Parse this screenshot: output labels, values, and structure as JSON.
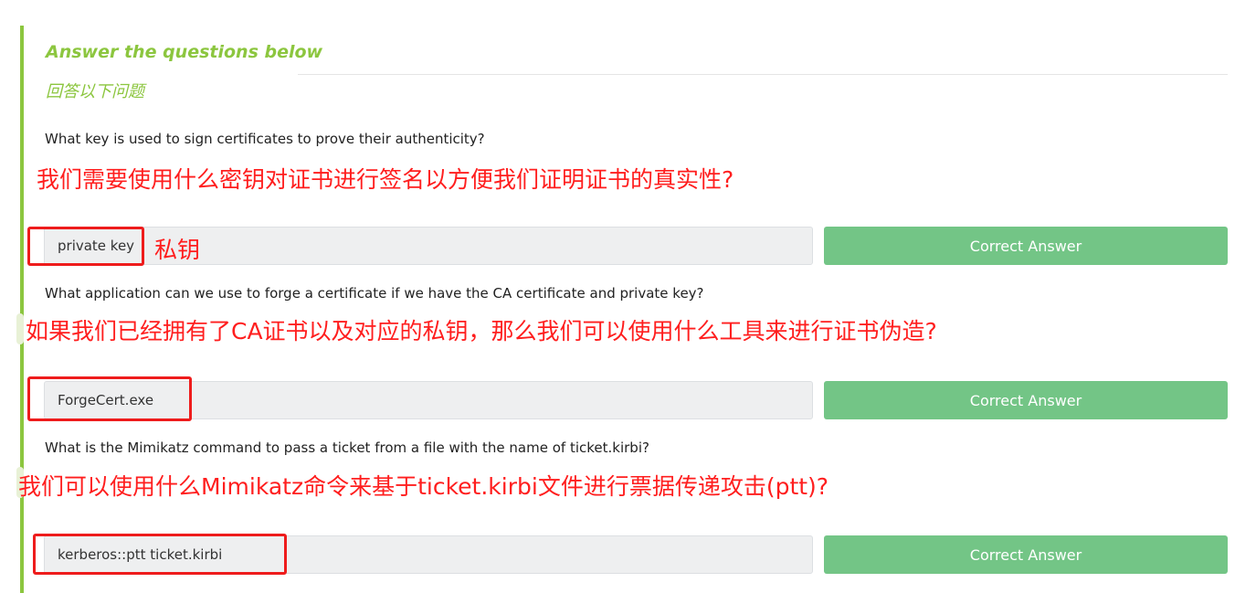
{
  "section": {
    "title": "Answer the questions below",
    "title_cn": "回答以下问题",
    "accent_color": "#8cc63f"
  },
  "questions": [
    {
      "text": "What key is used to sign certificates to prove their authenticity?",
      "annotation": "我们需要使用什么密钥对证书进行签名以方便我们证明证书的真实性?",
      "answer": "private key",
      "answer_note": "私钥",
      "button_label": "Correct Answer"
    },
    {
      "text": "What application can we use to forge a certificate if we have the CA certificate and private key?",
      "annotation": "如果我们已经拥有了CA证书以及对应的私钥，那么我们可以使用什么工具来进行证书伪造?",
      "answer": "ForgeCert.exe",
      "button_label": "Correct Answer"
    },
    {
      "text": "What is the Mimikatz command to pass a ticket from a file with the name of ticket.kirbi?",
      "annotation": "我们可以使用什么Mimikatz命令来基于ticket.kirbi文件进行票据传递攻击(ptt)?",
      "answer": "kerberos::ptt ticket.kirbi",
      "button_label": "Correct Answer"
    }
  ],
  "colors": {
    "button": "#73c586",
    "annotation": "#ff1e1e",
    "input_bg": "#eeeff0"
  }
}
